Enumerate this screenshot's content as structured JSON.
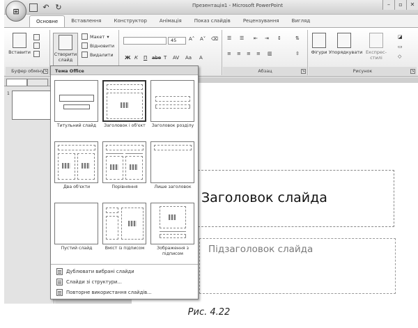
{
  "window": {
    "title": "Презентація1 - Microsoft PowerPoint",
    "office_button_label": "Office",
    "controls": [
      "–",
      "▫",
      "✕"
    ]
  },
  "tabs": [
    "Основне",
    "Вставлення",
    "Конструктор",
    "Анімація",
    "Показ слайдів",
    "Рецензування",
    "Вигляд"
  ],
  "ribbon": {
    "clipboard": {
      "paste_label": "Вставити",
      "group_label": "Буфер обміну"
    },
    "slides": {
      "new_slide_label": "Створити слайд",
      "layout_label": "Макет",
      "reset_label": "Відновити",
      "delete_label": "Видалити"
    },
    "font": {
      "size_value": "45",
      "buttons": [
        "Ж",
        "К",
        "П",
        "abe",
        "Т",
        "Аа",
        "А"
      ]
    },
    "paragraph": {
      "group_label": "Абзац"
    },
    "drawing": {
      "shapes_label": "Фігури",
      "arrange_label": "Упорядкувати",
      "quick_styles_label": "Експрес-стилі",
      "group_label": "Рисунок"
    }
  },
  "slides_pane": {
    "thumb_number": "1"
  },
  "slide": {
    "title_placeholder": "Заголовок слайда",
    "subtitle_placeholder": "Підзаголовок слайда"
  },
  "layout_menu": {
    "header": "Тема Office",
    "layouts": [
      "Титульний слайд",
      "Заголовок і об'єкт",
      "Заголовок розділу",
      "Два об'єкти",
      "Порівняння",
      "Лише заголовок",
      "Пустий слайд",
      "Вміст із підписом",
      "Зображення з підписом"
    ],
    "actions": [
      "Дублювати вибрані слайди",
      "Слайди зі структури...",
      "Повторне використання слайдів..."
    ]
  },
  "caption": "Рис. 4.22"
}
